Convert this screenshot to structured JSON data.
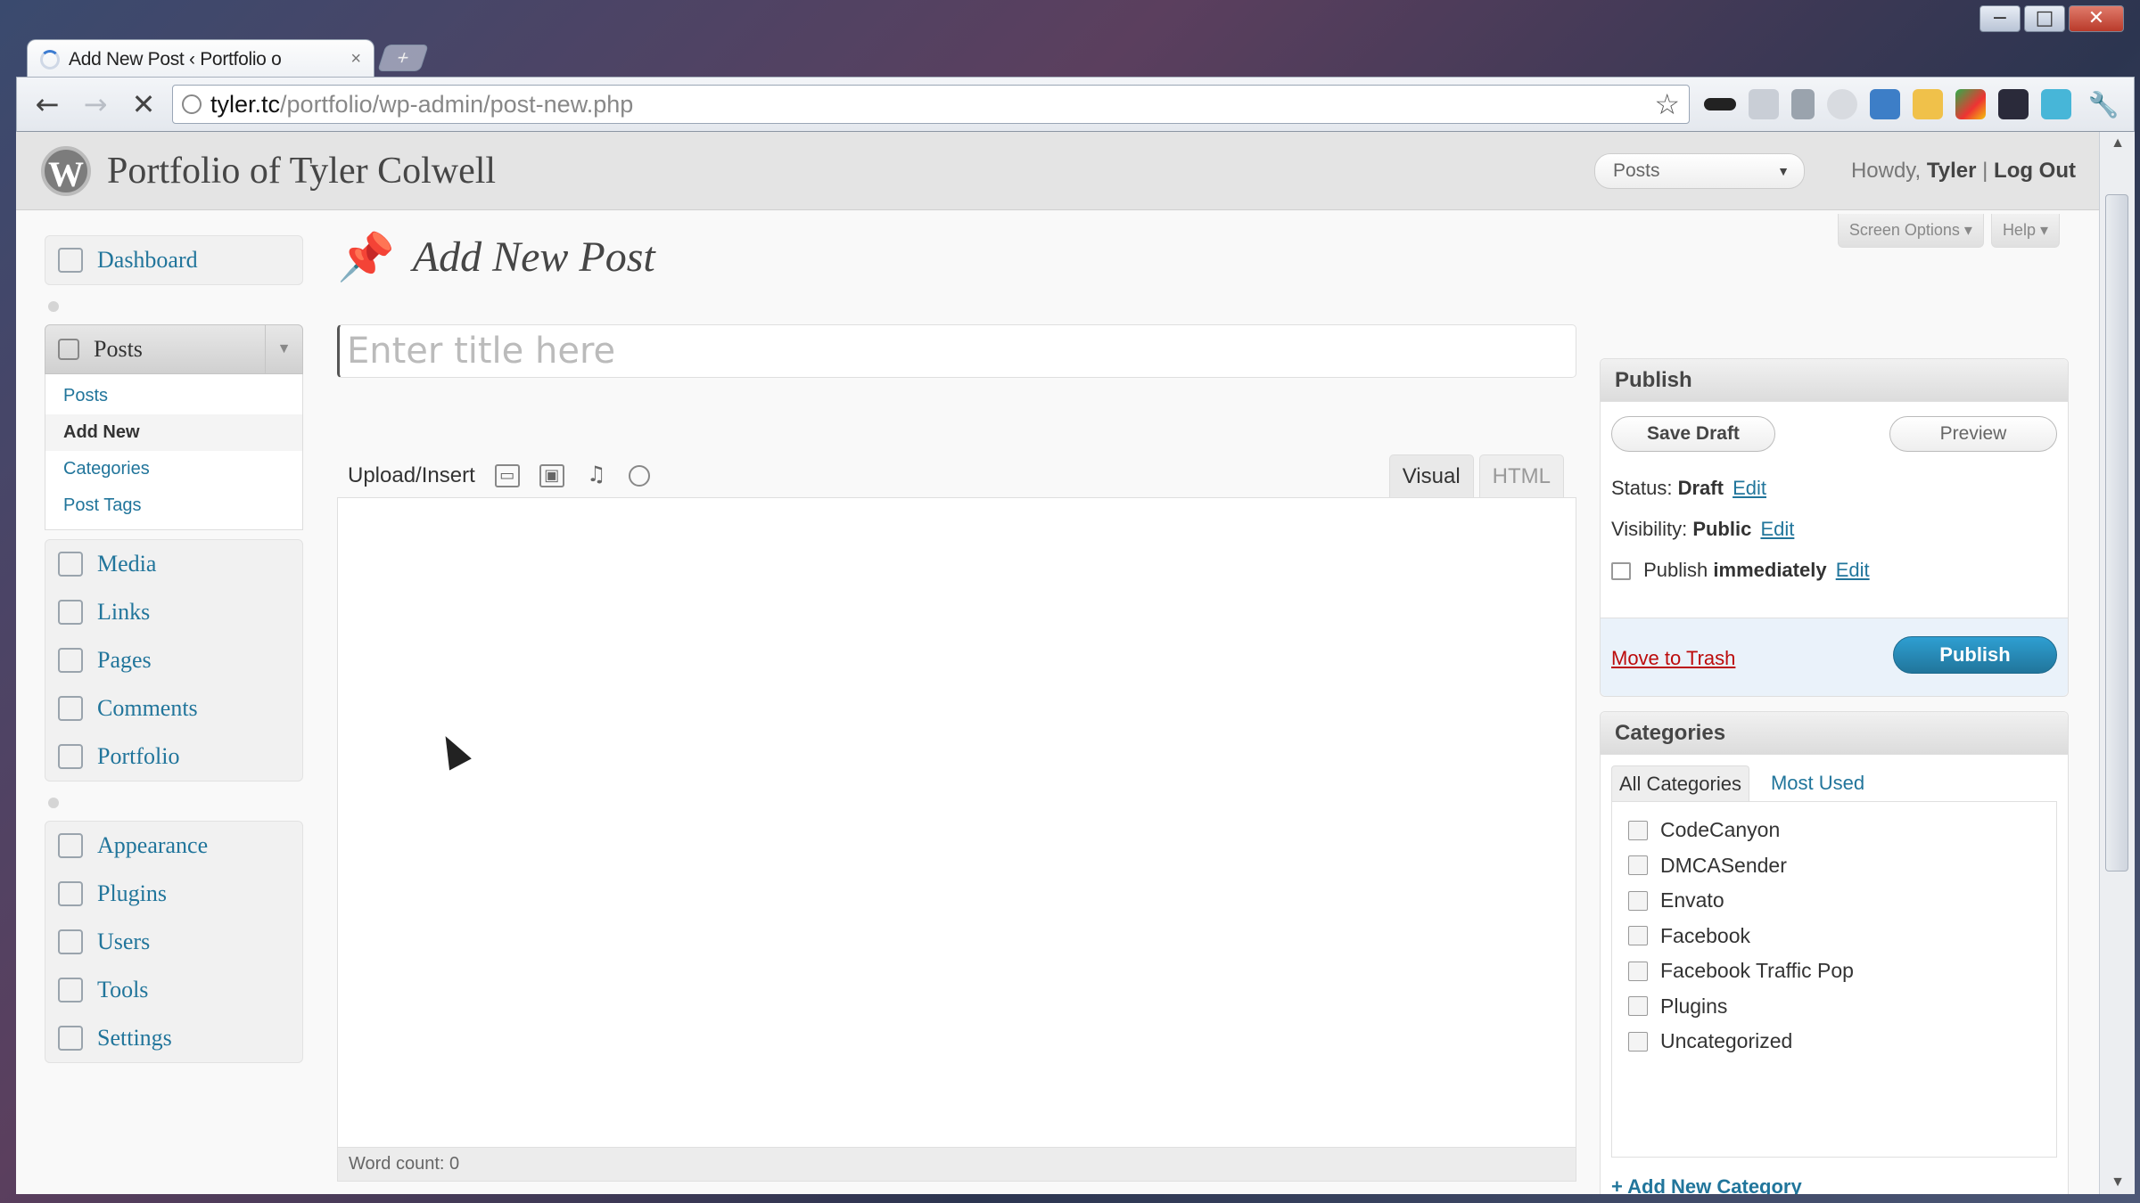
{
  "window": {
    "minimize": "−",
    "maximize": "□",
    "close": "✕"
  },
  "browser": {
    "tab": {
      "title": "Add New Post ‹ Portfolio o",
      "close": "×"
    },
    "new_tab": "+",
    "url_host": "tyler.tc",
    "url_path": "/portfolio/wp-admin/post-new.php",
    "back": "←",
    "forward": "→",
    "stop": "✕",
    "star": "☆",
    "wrench": "🔧"
  },
  "wp_header": {
    "logo": "W",
    "site_title": "Portfolio of Tyler Colwell",
    "favorite_actions": "Posts",
    "favorite_caret": "▼",
    "howdy_prefix": "Howdy,",
    "user": "Tyler",
    "separator": "|",
    "logout": "Log Out"
  },
  "screen_meta": {
    "screen_options": "Screen Options ▾",
    "help": "Help ▾"
  },
  "sidebar": {
    "dashboard": "Dashboard",
    "posts": "Posts",
    "posts_toggle": "▼",
    "posts_sub": [
      "Posts",
      "Add New",
      "Categories",
      "Post Tags"
    ],
    "group2": [
      "Media",
      "Links",
      "Pages",
      "Comments",
      "Portfolio"
    ],
    "group3": [
      "Appearance",
      "Plugins",
      "Users",
      "Tools",
      "Settings"
    ]
  },
  "main": {
    "pin_icon": "📌",
    "page_title": "Add New Post",
    "title_placeholder": "Enter title here",
    "upload_insert": "Upload/Insert",
    "media_icons": [
      "▭",
      "▣",
      "♫",
      "○"
    ],
    "tab_visual": "Visual",
    "tab_html": "HTML",
    "word_count": "Word count: 0"
  },
  "publish": {
    "heading": "Publish",
    "save_draft": "Save Draft",
    "preview": "Preview",
    "status_label": "Status:",
    "status_value": "Draft",
    "visibility_label": "Visibility:",
    "visibility_value": "Public",
    "publish_label": "Publish",
    "publish_value": "immediately",
    "edit": "Edit",
    "move_to_trash": "Move to Trash",
    "publish_button": "Publish"
  },
  "categories": {
    "heading": "Categories",
    "tab_all": "All Categories",
    "tab_most_used": "Most Used",
    "items": [
      "CodeCanyon",
      "DMCASender",
      "Envato",
      "Facebook",
      "Facebook Traffic Pop",
      "Plugins",
      "Uncategorized"
    ],
    "add_new": "+ Add New Category"
  }
}
